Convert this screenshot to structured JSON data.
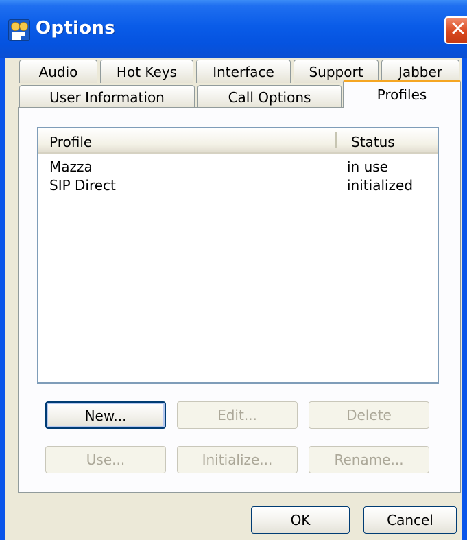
{
  "window": {
    "title": "Options",
    "icon": "app-icon",
    "close_glyph": "✕"
  },
  "tabs": {
    "row1": [
      {
        "label": "Audio"
      },
      {
        "label": "Hot Keys"
      },
      {
        "label": "Interface"
      },
      {
        "label": "Support"
      },
      {
        "label": "Jabber"
      }
    ],
    "row2": [
      {
        "label": "User Information"
      },
      {
        "label": "Call Options"
      },
      {
        "label": "Profiles",
        "active": true
      }
    ]
  },
  "profiles_list": {
    "columns": [
      "Profile",
      "Status"
    ],
    "rows": [
      {
        "profile": "Mazza",
        "status": "in use"
      },
      {
        "profile": "SIP Direct",
        "status": "initialized"
      }
    ]
  },
  "buttons": {
    "new": "New...",
    "edit": "Edit...",
    "delete": "Delete",
    "use": "Use...",
    "initialize": "Initialize...",
    "rename": "Rename...",
    "ok": "OK",
    "cancel": "Cancel"
  },
  "colors": {
    "titlebar": "#0a5ce8",
    "dialog_bg": "#ece9d8",
    "active_tab_accent": "#f5a623",
    "close_button": "#d9491f"
  }
}
